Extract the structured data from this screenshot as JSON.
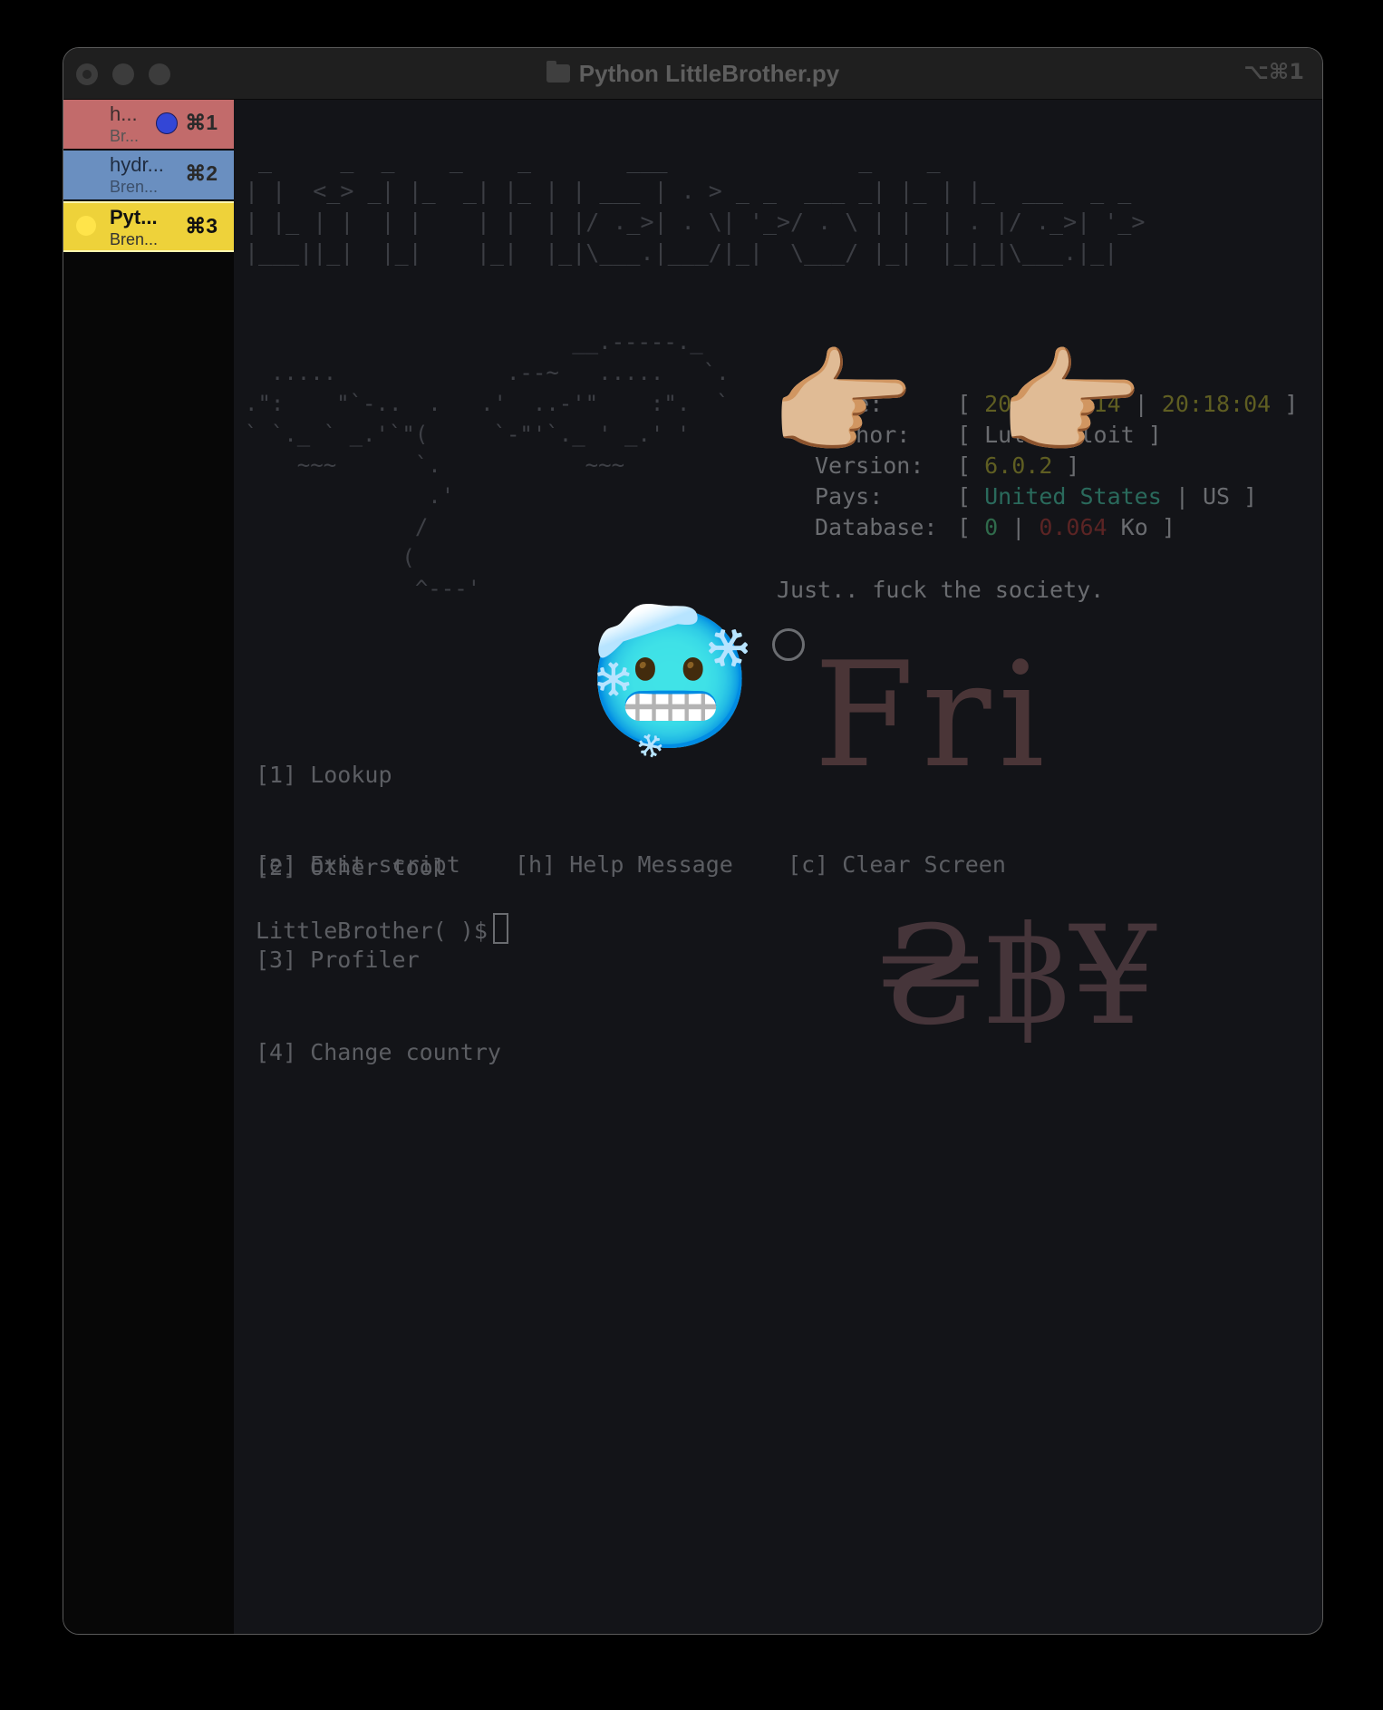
{
  "window": {
    "title": "Python LittleBrother.py",
    "shortcut": "⌥⌘1"
  },
  "tabs": [
    {
      "title": "h...",
      "subtitle": "Br...",
      "shortcut": "⌘1"
    },
    {
      "title": "hydr...",
      "subtitle": "Bren...",
      "shortcut": "⌘2"
    },
    {
      "title": "Pyt...",
      "subtitle": "Bren...",
      "shortcut": "⌘3"
    }
  ],
  "banner_art": " _     _  _    _    _       ___              _    _\n| |  <_> _| |_  _| |_ | | ___ | . > _ _  ___ _| |_ | |_  ___  _ _\n| |_ | |  | |    | |  | |/ ._>| . \\| '_>/ . \\ | |  | . |/ ._>| '_>\n|___||_|  |_|    |_|  |_|\\___.|___/|_|  \\___/ |_|  |_|_|\\___.|_|",
  "ascii_art": "                         __.-----._\n  .....             .--~   .....   `.\n.\":    \"`-..  .   .'  ..-'\"    :\".  `\n` `._ ` _.'`\"(     `-\"'`._ ' _.' '\n    ~~~      `.           ~~~\n              .'\n             /\n            (\n             ^---'",
  "info": {
    "time_label": "Time:",
    "time_date": "2023-02-14",
    "time_clock": "20:18:04",
    "author_label": "Author:",
    "author_value": "Lulz3xploit",
    "version_label": "Version:",
    "version_value": "6.0.2",
    "pays_label": "Pays:",
    "pays_country": "United States",
    "pays_code": "US",
    "db_label": "Database:",
    "db_count": "0",
    "db_size": "0.064",
    "db_unit": "Ko"
  },
  "slogan": "Just.. fuck the society.",
  "menu": [
    "[1] Lookup",
    "[2] Other tool",
    "[3] Profiler",
    "[4] Change country"
  ],
  "controls": {
    "exit": "[e] Exit script",
    "help": "[h] Help Message",
    "clear": "[c] Clear Screen"
  },
  "prompt": "LittleBrother( )$",
  "overlay": {
    "fri_text": "Fri",
    "currency_text": "₴฿¥",
    "face_emoji": "🥶",
    "pointing_emoji": "👉🏼"
  }
}
